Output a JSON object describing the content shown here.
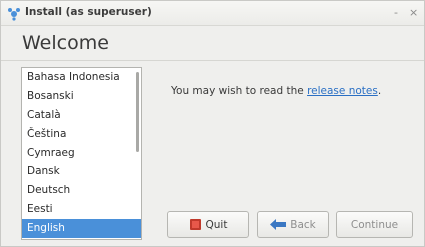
{
  "window": {
    "title": "Install (as superuser)",
    "minimize": "-",
    "close": "×"
  },
  "page": {
    "title": "Welcome"
  },
  "languages": {
    "items": [
      "Bahasa Indonesia",
      "Bosanski",
      "Català",
      "Čeština",
      "Cymraeg",
      "Dansk",
      "Deutsch",
      "Eesti",
      "English"
    ],
    "selected": "English"
  },
  "release": {
    "prefix": "You may wish to read the ",
    "link": "release notes",
    "suffix": "."
  },
  "watermark": "...",
  "buttons": {
    "quit": "Quit",
    "back": "Back",
    "continue": "Continue"
  },
  "colors": {
    "selection": "#4a90d9",
    "link": "#2a6fc4",
    "quit_icon": "#c0392b",
    "back_icon": "#3b78c3"
  }
}
